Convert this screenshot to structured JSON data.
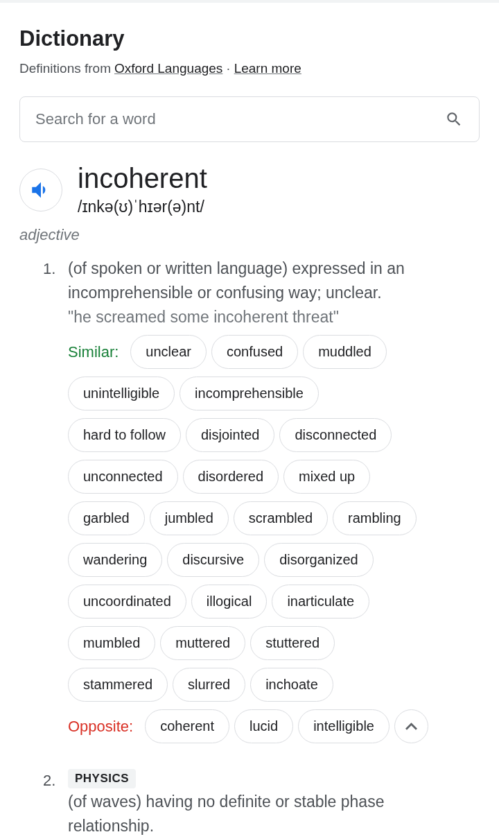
{
  "title": "Dictionary",
  "source": {
    "prefix": "Definitions from",
    "link": "Oxford Languages",
    "separator": "·",
    "learn_more": "Learn more"
  },
  "search": {
    "placeholder": "Search for a word"
  },
  "entry": {
    "word": "incoherent",
    "phonetic": "/ɪnkə(ʊ)ˈhɪər(ə)nt/",
    "part_of_speech": "adjective"
  },
  "senses": [
    {
      "number": "1.",
      "definition": "(of spoken or written language) expressed in an incomprehensible or confusing way; unclear.",
      "example": "\"he screamed some incoherent threat\"",
      "similar": {
        "label": "Similar:",
        "rows": [
          [
            "unclear",
            "confused",
            "muddled"
          ],
          [
            "unintelligible",
            "incomprehensible"
          ],
          [
            "hard to follow",
            "disjointed",
            "disconnected"
          ],
          [
            "unconnected",
            "disordered",
            "mixed up"
          ],
          [
            "garbled",
            "jumbled",
            "scrambled",
            "rambling"
          ],
          [
            "wandering",
            "discursive",
            "disorganized"
          ],
          [
            "uncoordinated",
            "illogical",
            "inarticulate"
          ],
          [
            "mumbled",
            "muttered",
            "stuttered"
          ],
          [
            "stammered",
            "slurred",
            "inchoate"
          ]
        ]
      },
      "opposite": {
        "label": "Opposite:",
        "words": [
          "coherent",
          "lucid",
          "intelligible"
        ],
        "expanded": true
      }
    },
    {
      "number": "2.",
      "domain": "PHYSICS",
      "definition": "(of waves) having no definite or stable phase relationship."
    }
  ]
}
